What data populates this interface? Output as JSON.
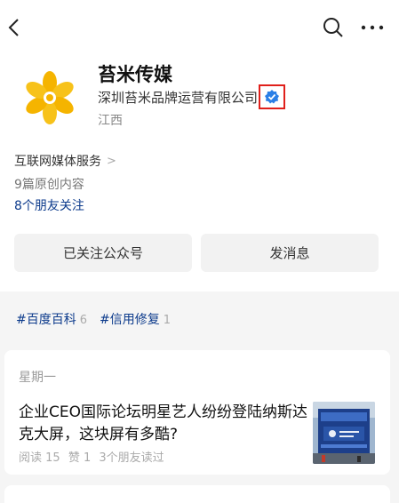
{
  "account": {
    "name": "苔米传媒",
    "company": "深圳苔米品牌运营有限公司",
    "region": "江西",
    "service": "互联网媒体服务",
    "original_count": "9篇原创内容",
    "friends_following": "8个朋友关注"
  },
  "buttons": {
    "followed": "已关注公众号",
    "message": "发消息"
  },
  "tags": [
    {
      "label": "#百度百科",
      "count": "6"
    },
    {
      "label": "#信用修复",
      "count": "1"
    }
  ],
  "article": {
    "weekday": "星期一",
    "title": "企业CEO国际论坛明星艺人纷纷登陆纳斯达克大屏，这块屏有多酷?",
    "reads": "阅读 15",
    "likes": "赞 1",
    "friends_read": "3个朋友读过"
  },
  "colors": {
    "link_blue": "#0d3b8c",
    "verify_blue": "#2a7fe6",
    "highlight_red": "#e0201b",
    "logo_yellow": "#f5b400"
  },
  "icons": [
    "back-icon",
    "search-icon",
    "more-icon",
    "verified-icon",
    "chevron-right-icon"
  ]
}
